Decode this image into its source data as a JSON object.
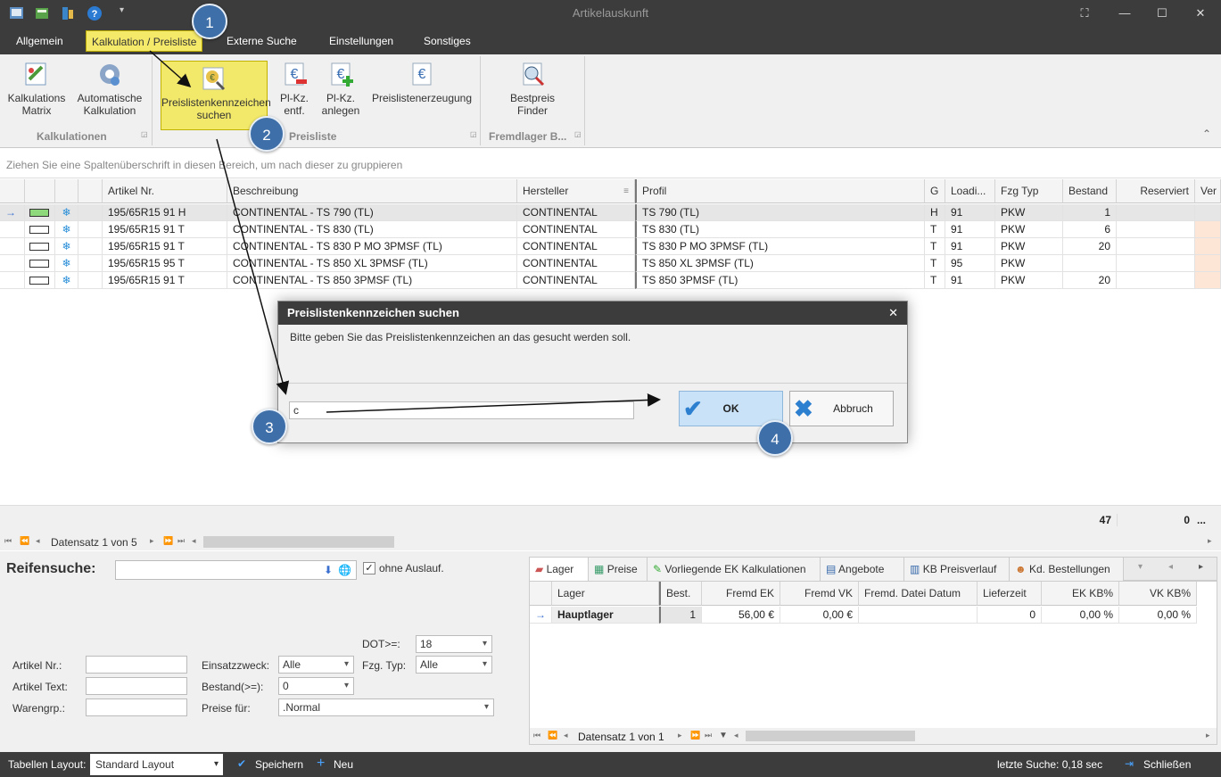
{
  "window": {
    "title": "Artikelauskunft"
  },
  "menu": {
    "tabs": [
      "Allgemein",
      "Kalkulation / Preisliste",
      "Externe Suche",
      "Einstellungen",
      "Sonstiges"
    ]
  },
  "ribbon": {
    "btn_kalk_matrix": [
      "Kalkulations",
      "Matrix"
    ],
    "btn_auto_kalk": [
      "Automatische",
      "Kalkulation"
    ],
    "btn_pl_search": [
      "Preislistenkennzeichen",
      "suchen"
    ],
    "btn_pl_entf": [
      "Pl-Kz.",
      "entf."
    ],
    "btn_pl_anlegen": [
      "Pl-Kz.",
      "anlegen"
    ],
    "btn_pl_erzeugung": "Preislistenerzeugung",
    "btn_bestpreis": [
      "Bestpreis",
      "Finder"
    ],
    "group_kalk": "Kalkulationen",
    "group_preisliste": "Preisliste",
    "group_fremd": "Fremdlager B..."
  },
  "grouping_hint": "Ziehen Sie eine Spaltenüberschrift in diesen Bereich, um nach dieser zu gruppieren",
  "grid": {
    "headers": [
      "Artikel Nr.",
      "Beschreibung",
      "Hersteller",
      "Profil",
      "G",
      "Loadi...",
      "Fzg Typ",
      "Bestand",
      "Reserviert",
      "Ver"
    ],
    "rows": [
      {
        "artikel": "195/65R15 91 H",
        "beschreibung": "CONTINENTAL - TS 790 (TL)",
        "hersteller": "CONTINENTAL",
        "profil": "TS 790 (TL)",
        "g": "H",
        "load": "91",
        "fzg": "PKW",
        "bestand": "1"
      },
      {
        "artikel": "195/65R15 91 T",
        "beschreibung": "CONTINENTAL - TS 830 (TL)",
        "hersteller": "CONTINENTAL",
        "profil": "TS 830 (TL)",
        "g": "T",
        "load": "91",
        "fzg": "PKW",
        "bestand": "6"
      },
      {
        "artikel": "195/65R15 91 T",
        "beschreibung": "CONTINENTAL - TS 830 P MO 3PMSF (TL)",
        "hersteller": "CONTINENTAL",
        "profil": "TS 830 P MO 3PMSF (TL)",
        "g": "T",
        "load": "91",
        "fzg": "PKW",
        "bestand": "20"
      },
      {
        "artikel": "195/65R15 95 T",
        "beschreibung": "CONTINENTAL - TS 850 XL 3PMSF (TL)",
        "hersteller": "CONTINENTAL",
        "profil": "TS 850 XL 3PMSF (TL)",
        "g": "T",
        "load": "95",
        "fzg": "PKW",
        "bestand": ""
      },
      {
        "artikel": "195/65R15 91 T",
        "beschreibung": "CONTINENTAL - TS 850 3PMSF (TL)",
        "hersteller": "CONTINENTAL",
        "profil": "TS 850 3PMSF (TL)",
        "g": "T",
        "load": "91",
        "fzg": "PKW",
        "bestand": "20"
      }
    ],
    "footer_bestand": "47",
    "footer_reserviert": "0",
    "footer_more": "...",
    "record_nav": "Datensatz 1 von 5"
  },
  "dialog": {
    "title": "Preislistenkennzeichen suchen",
    "message": "Bitte geben Sie das Preislistenkennzeichen an das gesucht werden soll.",
    "input_value": "c",
    "ok": "OK",
    "cancel": "Abbruch"
  },
  "search": {
    "title": "Reifensuche:",
    "ohne_auslauf": "ohne Auslauf.",
    "dot_label": "DOT>=:",
    "dot_value": "18",
    "artikel_nr": "Artikel Nr.:",
    "artikel_text": "Artikel Text:",
    "warengrp": "Warengrp.:",
    "einsatz_label": "Einsatzzweck:",
    "einsatz_value": "Alle",
    "bestand_label": "Bestand(>=):",
    "bestand_value": "0",
    "preise_label": "Preise für:",
    "preise_value": ".Normal",
    "fzg_label": "Fzg. Typ:",
    "fzg_value": "Alle"
  },
  "detail": {
    "tabs": [
      "Lager",
      "Preise",
      "Vorliegende EK Kalkulationen",
      "Angebote",
      "KB Preisverlauf",
      "Kd. Bestellungen"
    ],
    "headers": [
      "Lager",
      "Best.",
      "Fremd EK",
      "Fremd VK",
      "Fremd. Datei Datum",
      "Lieferzeit",
      "EK KB%",
      "VK KB%"
    ],
    "row": {
      "lager": "Hauptlager",
      "best": "1",
      "fremd_ek": "56,00 €",
      "fremd_vk": "0,00 €",
      "datum": "",
      "lieferzeit": "0",
      "ek_kb": "0,00 %",
      "vk_kb": "0,00 %"
    },
    "record_nav": "Datensatz 1 von 1"
  },
  "status": {
    "layout_label": "Tabellen Layout:",
    "layout_value": "Standard Layout",
    "save": "Speichern",
    "new": "Neu",
    "last_search": "letzte Suche: 0,18 sec",
    "close": "Schließen"
  },
  "badges": [
    "1",
    "2",
    "3",
    "4"
  ],
  "colors": {
    "chrome": "#3c3c3c",
    "highlight": "#f5e96a",
    "badge": "#3f6fa8",
    "ok_button": "#c9e2f7"
  }
}
